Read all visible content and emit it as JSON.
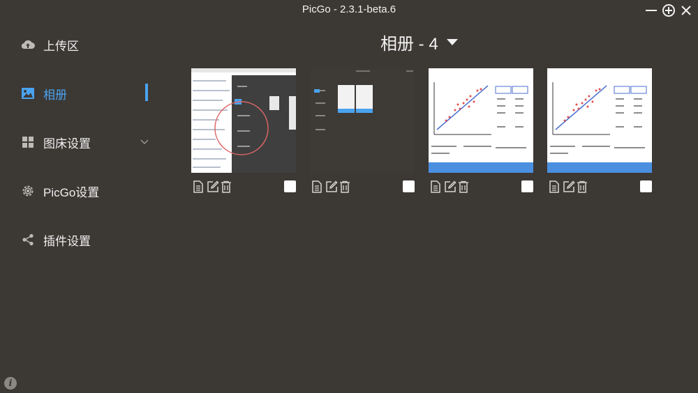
{
  "window": {
    "title": "PicGo - 2.3.1-beta.6"
  },
  "sidebar": {
    "items": [
      {
        "label": "上传区",
        "icon": "cloud-upload-icon"
      },
      {
        "label": "相册",
        "icon": "image-icon"
      },
      {
        "label": "图床设置",
        "icon": "grid-icon"
      },
      {
        "label": "PicGo设置",
        "icon": "gear-icon"
      },
      {
        "label": "插件设置",
        "icon": "share-icon"
      }
    ],
    "active_index": 1
  },
  "gallery": {
    "title": "相册 - 4",
    "cards": [
      {
        "thumb": "doc-screenshot"
      },
      {
        "thumb": "dark-screenshot"
      },
      {
        "thumb": "house-chart"
      },
      {
        "thumb": "house-chart"
      }
    ]
  },
  "colors": {
    "background": "#3c3834",
    "accent": "#4aa3f0"
  }
}
